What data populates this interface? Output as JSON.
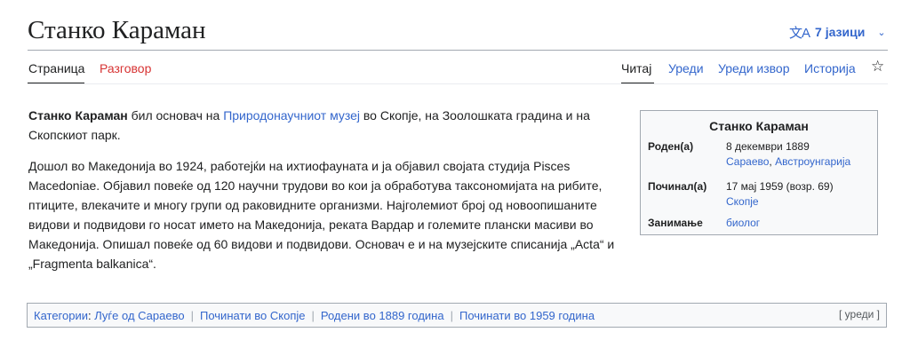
{
  "page": {
    "title": "Станко Караман",
    "languages_label": "7 јазици",
    "translate_icon": "文A"
  },
  "tabs": {
    "page": "Страница",
    "talk": "Разговор",
    "read": "Читај",
    "edit": "Уреди",
    "edit_source": "Уреди извор",
    "history": "Историја",
    "watch_icon": "☆"
  },
  "article": {
    "p1": {
      "bold": "Станко Караман",
      "t1": " бил основач на ",
      "link": "Природонаучниот музеј",
      "t2": " во Скопје, на Зоолошката градина и на Скопскиот парк."
    },
    "p2": "Дошол во Македонија во 1924, работејќи на ихтиофауната и ја објавил својата студија Pisces Macedoniae. Објавил повеќе од 120 научни трудови во кои ја обработува таксономијата на рибите, птиците, влекачите и многу групи од раковидните организми. Најголемиот број од новоопишаните видови и подвидови го носат името на Македонија, реката Вардар и големите плански масиви во Македонија. Опишал повеќе од 60 видови и подвидови. Основач е и на музејските списанија „Acta“ и „Fragmenta balkanica“."
  },
  "infobox": {
    "title": "Станко Караман",
    "born_label": "Роден(а)",
    "born_date": "8 декември 1889",
    "born_place_1": "Сараево",
    "born_place_sep": ", ",
    "born_place_2": "Австроунгарија",
    "died_label": "Починал(а)",
    "died_date": "17 мај 1959 (возр. 69)",
    "died_place": "Скопје",
    "occupation_label": "Занимање",
    "occupation": "биолог"
  },
  "categories": {
    "label": "Категории",
    "colon": ":",
    "items": [
      "Луѓе од Сараево",
      "Починати во Скопје",
      "Родени во 1889 година",
      "Починати во 1959 година"
    ],
    "edit_label": "[ уреди ]"
  }
}
